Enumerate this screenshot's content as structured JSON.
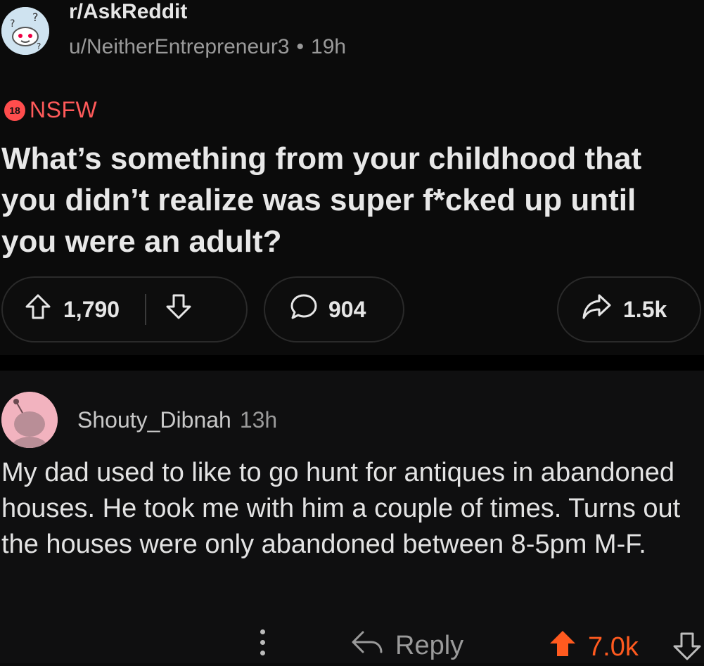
{
  "post": {
    "subreddit": "r/AskReddit",
    "author": "u/NeitherEntrepreneur3",
    "separator": "•",
    "age": "19h",
    "nsfw_badge": "18",
    "nsfw_label": "NSFW",
    "title": "What’s something from your childhood that you didn’t realize was super f*cked up until you were an adult?",
    "score": "1,790",
    "comments": "904",
    "shares": "1.5k",
    "icons": {
      "upvote": "upvote-arrow-icon",
      "downvote": "downvote-arrow-icon",
      "comment": "speech-bubble-icon",
      "share": "share-arrow-icon"
    }
  },
  "comment": {
    "author": "Shouty_Dibnah",
    "age": "13h",
    "body": "My dad used to like to go hunt for antiques in abandoned houses.  He took me with him a couple of times.  Turns out the houses were only abandoned between 8-5pm M-F.",
    "reply_label": "Reply",
    "score": "7.0k",
    "score_color": "#ff5a1f"
  },
  "colors": {
    "background": "#0b0b0b",
    "nsfw": "#ff5a5a",
    "upvoted": "#ff5a1f"
  }
}
